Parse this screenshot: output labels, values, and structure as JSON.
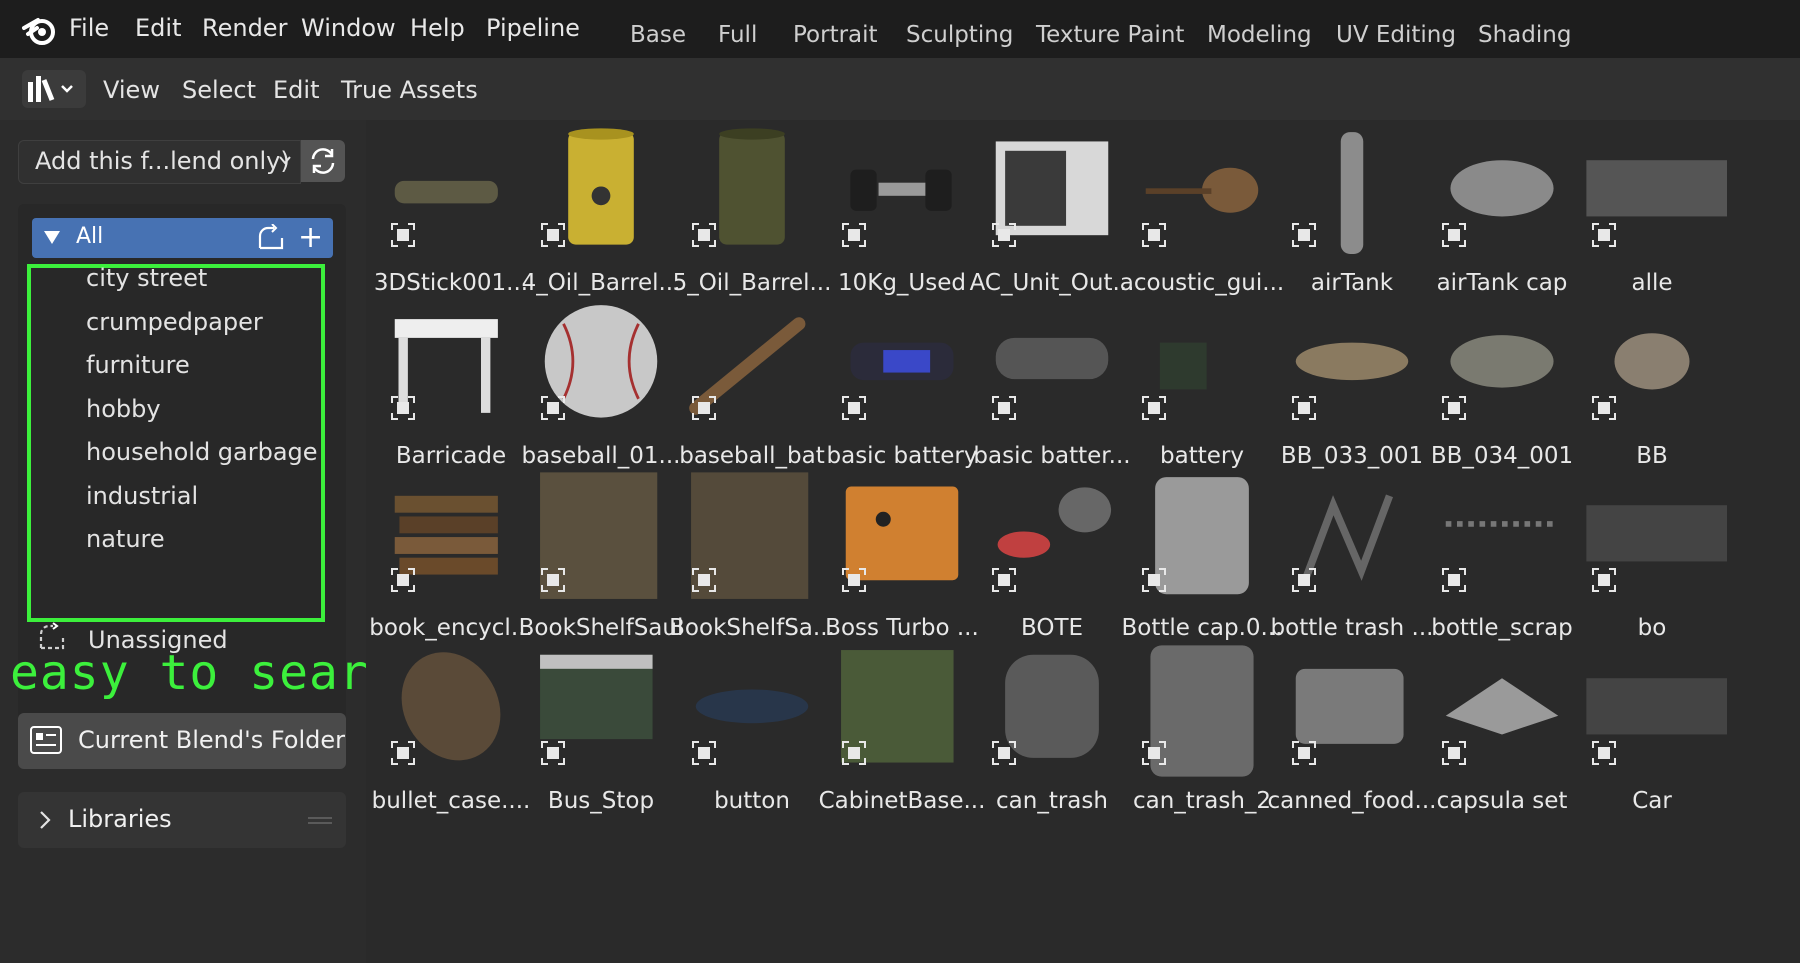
{
  "topbar": {
    "menus": [
      "File",
      "Edit",
      "Render",
      "Window",
      "Help",
      "Pipeline"
    ],
    "workspaces": [
      "Base",
      "Full",
      "Portrait",
      "Sculpting",
      "Texture Paint",
      "Modeling",
      "UV Editing",
      "Shading"
    ]
  },
  "header": {
    "editor_icon": "asset-browser-icon",
    "menus": [
      "View",
      "Select",
      "Edit",
      "True Assets"
    ]
  },
  "sidebar": {
    "import_method": "Add this f...lend only)",
    "all_label": "All",
    "categories": [
      "city street",
      "crumpedpaper",
      "furniture",
      "hobby",
      "household garbage",
      "industrial",
      "nature"
    ],
    "unassigned_label": "Unassigned",
    "annotation": "easy to search",
    "current_blend_label": "Current Blend's Folder",
    "libraries_label": "Libraries"
  },
  "assets": [
    "3DStick001...",
    "4_Oil_Barrel...",
    "5_Oil_Barrel...",
    "10Kg_Used",
    "AC_Unit_Out...",
    "acoustic_gui...",
    "airTank",
    "airTank cap",
    "alle",
    "Barricade",
    "baseball_01...",
    "baseball_bat",
    "basic battery",
    "basic batter...",
    "battery",
    "BB_033_001",
    "BB_034_001",
    "BB",
    "book_encycl...",
    "BookShelfSaul",
    "BookShelfSa...",
    "Boss Turbo ...",
    "BOTE",
    "Bottle cap.0...",
    "bottle trash ...",
    "bottle_scrap",
    "bo",
    "bullet_case....",
    "Bus_Stop",
    "button",
    "CabinetBase...",
    "can_trash",
    "can_trash_2",
    "canned_food...",
    "capsula set",
    "Car"
  ],
  "colors": {
    "accent": "#4772b3",
    "highlight": "#3cf03c",
    "background": "#262626"
  }
}
